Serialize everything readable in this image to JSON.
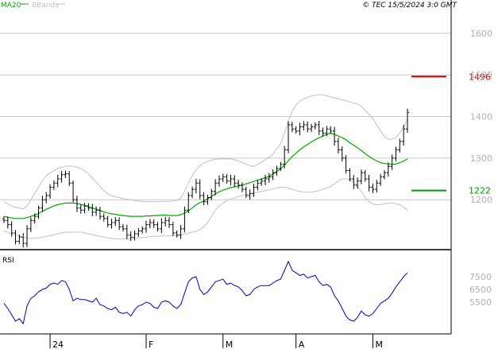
{
  "header": {
    "ma_label": "MA20",
    "bbands_label": "BBands",
    "copyright": "© TEC 15/5/2024 3:0 GMT"
  },
  "colors": {
    "ma": "#00aa00",
    "bbands": "#c0c0c0",
    "price": "#000000",
    "rsi": "#0000cc",
    "resistance": "#cc0000",
    "support": "#009900",
    "grid": "#c8c8c8",
    "axis_text": "#b0b0b0"
  },
  "chart_data": [
    {
      "type": "ohlc",
      "title": "",
      "ylim": [
        1080,
        1680
      ],
      "yticks": [
        1200,
        1300,
        1400,
        1500,
        1600
      ],
      "ytick_labels": [
        "1200",
        "1300",
        "1400",
        "1500",
        "1600"
      ],
      "levels": [
        {
          "label": "1496",
          "value": 1496,
          "kind": "resistance"
        },
        {
          "label": "1222",
          "value": 1222,
          "kind": "support"
        }
      ],
      "close": [
        1150,
        1140,
        1120,
        1100,
        1110,
        1095,
        1130,
        1150,
        1160,
        1180,
        1200,
        1210,
        1230,
        1240,
        1250,
        1260,
        1262,
        1240,
        1200,
        1180,
        1175,
        1185,
        1180,
        1170,
        1175,
        1160,
        1155,
        1140,
        1145,
        1150,
        1135,
        1130,
        1115,
        1110,
        1118,
        1125,
        1130,
        1140,
        1145,
        1140,
        1130,
        1145,
        1150,
        1140,
        1120,
        1115,
        1130,
        1175,
        1210,
        1225,
        1240,
        1210,
        1195,
        1205,
        1220,
        1240,
        1250,
        1255,
        1245,
        1250,
        1240,
        1235,
        1225,
        1210,
        1215,
        1230,
        1240,
        1245,
        1250,
        1255,
        1265,
        1275,
        1285,
        1320,
        1380,
        1370,
        1365,
        1375,
        1380,
        1370,
        1375,
        1380,
        1365,
        1360,
        1370,
        1365,
        1340,
        1320,
        1300,
        1270,
        1250,
        1235,
        1245,
        1265,
        1250,
        1230,
        1225,
        1240,
        1255,
        1265,
        1280,
        1300,
        1320,
        1340,
        1370,
        1410
      ],
      "ma": [
        1160,
        1158,
        1156,
        1155,
        1155,
        1155,
        1157,
        1160,
        1163,
        1167,
        1172,
        1177,
        1181,
        1185,
        1188,
        1190,
        1192,
        1192,
        1192,
        1191,
        1189,
        1186,
        1183,
        1180,
        1177,
        1174,
        1171,
        1168,
        1166,
        1165,
        1163,
        1162,
        1161,
        1160,
        1160,
        1160,
        1160,
        1161,
        1161,
        1162,
        1162,
        1163,
        1163,
        1162,
        1162,
        1162,
        1164,
        1168,
        1173,
        1180,
        1188,
        1193,
        1197,
        1202,
        1208,
        1214,
        1219,
        1223,
        1226,
        1229,
        1231,
        1233,
        1235,
        1238,
        1241,
        1244,
        1247,
        1250,
        1253,
        1256,
        1262,
        1268,
        1274,
        1283,
        1294,
        1304,
        1312,
        1320,
        1327,
        1333,
        1339,
        1344,
        1349,
        1353,
        1357,
        1360,
        1357,
        1353,
        1349,
        1344,
        1337,
        1331,
        1325,
        1318,
        1311,
        1304,
        1298,
        1293,
        1289,
        1287,
        1286,
        1285,
        1286,
        1289,
        1293,
        1298
      ],
      "bb_upper": [
        1195,
        1190,
        1185,
        1182,
        1180,
        1178,
        1185,
        1200,
        1215,
        1230,
        1245,
        1258,
        1265,
        1270,
        1275,
        1278,
        1280,
        1281,
        1280,
        1278,
        1275,
        1270,
        1262,
        1252,
        1242,
        1232,
        1222,
        1214,
        1210,
        1207,
        1205,
        1203,
        1201,
        1200,
        1198,
        1197,
        1196,
        1195,
        1195,
        1195,
        1195,
        1196,
        1196,
        1196,
        1197,
        1198,
        1205,
        1220,
        1240,
        1258,
        1272,
        1282,
        1288,
        1292,
        1295,
        1297,
        1298,
        1298,
        1298,
        1298,
        1296,
        1293,
        1290,
        1285,
        1282,
        1280,
        1285,
        1290,
        1296,
        1302,
        1310,
        1322,
        1335,
        1360,
        1390,
        1412,
        1428,
        1437,
        1442,
        1446,
        1450,
        1451,
        1452,
        1452,
        1450,
        1447,
        1445,
        1442,
        1440,
        1438,
        1435,
        1432,
        1430,
        1425,
        1415,
        1405,
        1395,
        1380,
        1365,
        1352,
        1345,
        1345,
        1350,
        1360,
        1375,
        1395
      ],
      "bb_lower": [
        1125,
        1122,
        1118,
        1115,
        1113,
        1110,
        1108,
        1107,
        1107,
        1108,
        1110,
        1112,
        1114,
        1116,
        1118,
        1120,
        1122,
        1122,
        1122,
        1122,
        1122,
        1120,
        1118,
        1116,
        1114,
        1112,
        1110,
        1108,
        1107,
        1106,
        1106,
        1106,
        1106,
        1106,
        1107,
        1108,
        1109,
        1110,
        1111,
        1112,
        1112,
        1113,
        1113,
        1113,
        1113,
        1114,
        1115,
        1118,
        1120,
        1122,
        1124,
        1128,
        1135,
        1145,
        1160,
        1175,
        1185,
        1192,
        1198,
        1202,
        1205,
        1207,
        1210,
        1212,
        1214,
        1216,
        1218,
        1220,
        1222,
        1224,
        1226,
        1228,
        1230,
        1230,
        1228,
        1225,
        1222,
        1220,
        1218,
        1218,
        1218,
        1220,
        1222,
        1225,
        1228,
        1232,
        1238,
        1245,
        1250,
        1250,
        1248,
        1242,
        1232,
        1220,
        1205,
        1195,
        1190,
        1188,
        1188,
        1190,
        1192,
        1192,
        1190,
        1188,
        1182,
        1175
      ]
    },
    {
      "type": "line",
      "title": "RSI",
      "ylim": [
        30,
        95
      ],
      "yticks": [
        55,
        65,
        75
      ],
      "ytick_labels": [
        "5500",
        "6500",
        "7500"
      ],
      "x_labels": [
        {
          "label": "24",
          "index": 12
        },
        {
          "label": "F",
          "index": 37
        },
        {
          "label": "M",
          "index": 57
        },
        {
          "label": "A",
          "index": 76
        },
        {
          "label": "M",
          "index": 96
        }
      ],
      "series": [
        {
          "values": [
            54,
            50,
            45,
            40,
            42,
            38,
            52,
            58,
            60,
            63,
            65,
            66,
            69,
            70,
            69,
            72,
            71,
            65,
            56,
            58,
            57,
            57,
            56,
            55,
            58,
            53,
            52,
            50,
            49,
            51,
            47,
            46,
            47,
            44,
            49,
            52,
            53,
            55,
            54,
            51,
            50,
            55,
            56,
            55,
            52,
            50,
            53,
            62,
            71,
            74,
            75,
            65,
            61,
            63,
            67,
            71,
            72,
            73,
            69,
            70,
            68,
            67,
            64,
            60,
            61,
            65,
            67,
            68,
            68,
            68,
            70,
            72,
            73,
            80,
            87,
            80,
            78,
            76,
            77,
            74,
            75,
            76,
            71,
            68,
            69,
            67,
            60,
            56,
            50,
            44,
            41,
            40,
            43,
            48,
            45,
            44,
            46,
            50,
            54,
            56,
            58,
            62,
            67,
            71,
            75,
            78
          ]
        }
      ]
    }
  ]
}
